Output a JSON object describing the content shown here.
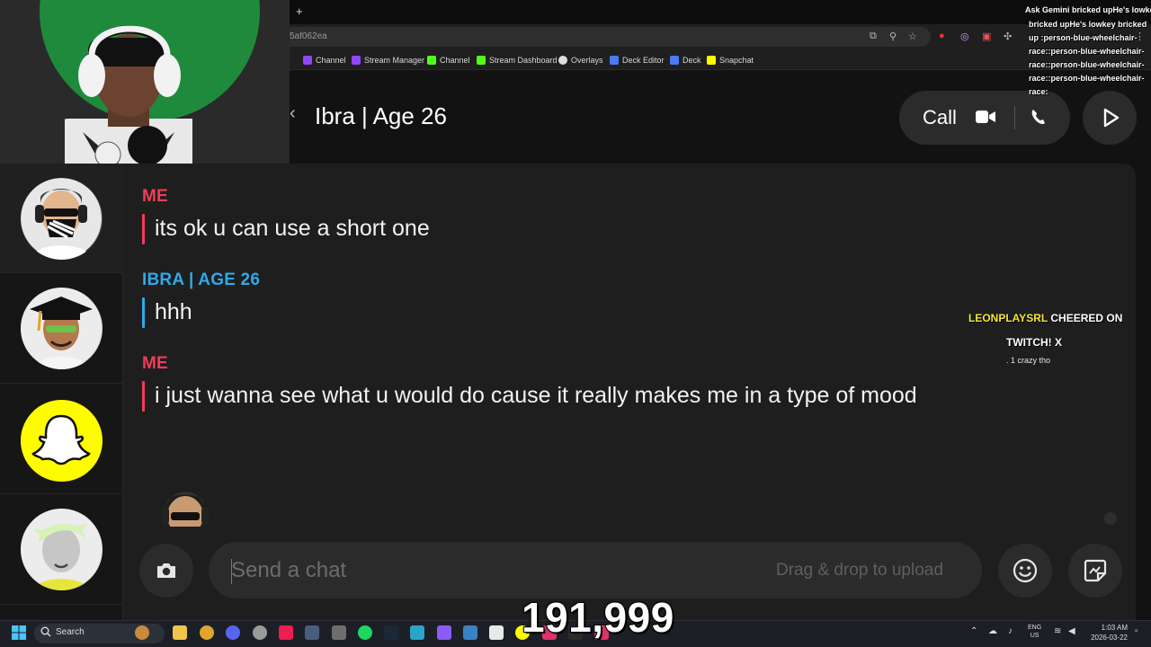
{
  "browser": {
    "new_tab_label": "+",
    "ask_label": "Ask Gemini",
    "url_fragment": "5af062ea",
    "bookmarks": [
      {
        "label": "Channel",
        "color": "#9146ff"
      },
      {
        "label": "Stream Manager",
        "color": "#9146ff"
      },
      {
        "label": "Channel",
        "color": "#53fc18"
      },
      {
        "label": "Stream Dashboard",
        "color": "#53fc18"
      },
      {
        "label": "Overlays",
        "color": "#dddddd"
      },
      {
        "label": "Deck Editor",
        "color": "#4a7bf7"
      },
      {
        "label": "Deck",
        "color": "#4a7bf7"
      },
      {
        "label": "Snapchat",
        "color": "#fffc00"
      }
    ]
  },
  "chat_header": {
    "title": "Ibra | Age 26",
    "call_label": "Call",
    "icons": [
      "video-icon",
      "phone-icon",
      "play-icon"
    ]
  },
  "sidebar": {
    "items": [
      {
        "name": "bitmoji-masked-avatar",
        "active": true
      },
      {
        "name": "bitmoji-graduate-avatar",
        "active": false
      },
      {
        "name": "snapchat-ghost-avatar",
        "active": false
      },
      {
        "name": "bitmoji-green-hair-avatar",
        "active": false
      }
    ]
  },
  "messages": [
    {
      "sender": "ME",
      "text": "its ok u can use a short one",
      "type": "me"
    },
    {
      "sender": "IBRA | AGE 26",
      "text": "hhh",
      "type": "them"
    },
    {
      "sender": "ME",
      "text": "i just wanna see what u would do cause it really makes me in a type of mood",
      "type": "me"
    }
  ],
  "composer": {
    "placeholder": "Send a chat",
    "drag_hint": "Drag & drop to upload"
  },
  "overlays": {
    "alert_user": "LEONPLAYSRL",
    "alert_action": " CHEERED ON",
    "alert_line2": "TWITCH! X",
    "alert_line3": ". 1 crazy tho",
    "ticker_top": "Ask Gemini bricked upHe's lowkey",
    "ticker_body": "bricked upHe's lowkey bricked up :person-blue-wheelchair-race::person-blue-wheelchair-race::person-blue-wheelchair-race::person-blue-wheelchair-race:",
    "counter": "191,999"
  },
  "taskbar": {
    "search_label": "Search",
    "lang_top": "ENG",
    "lang_bottom": "US",
    "time": "1:03 AM",
    "date": "2026-03-22"
  },
  "colors": {
    "me": "#f23c57",
    "them": "#2fa9e8",
    "snap_yellow": "#fffc00"
  }
}
